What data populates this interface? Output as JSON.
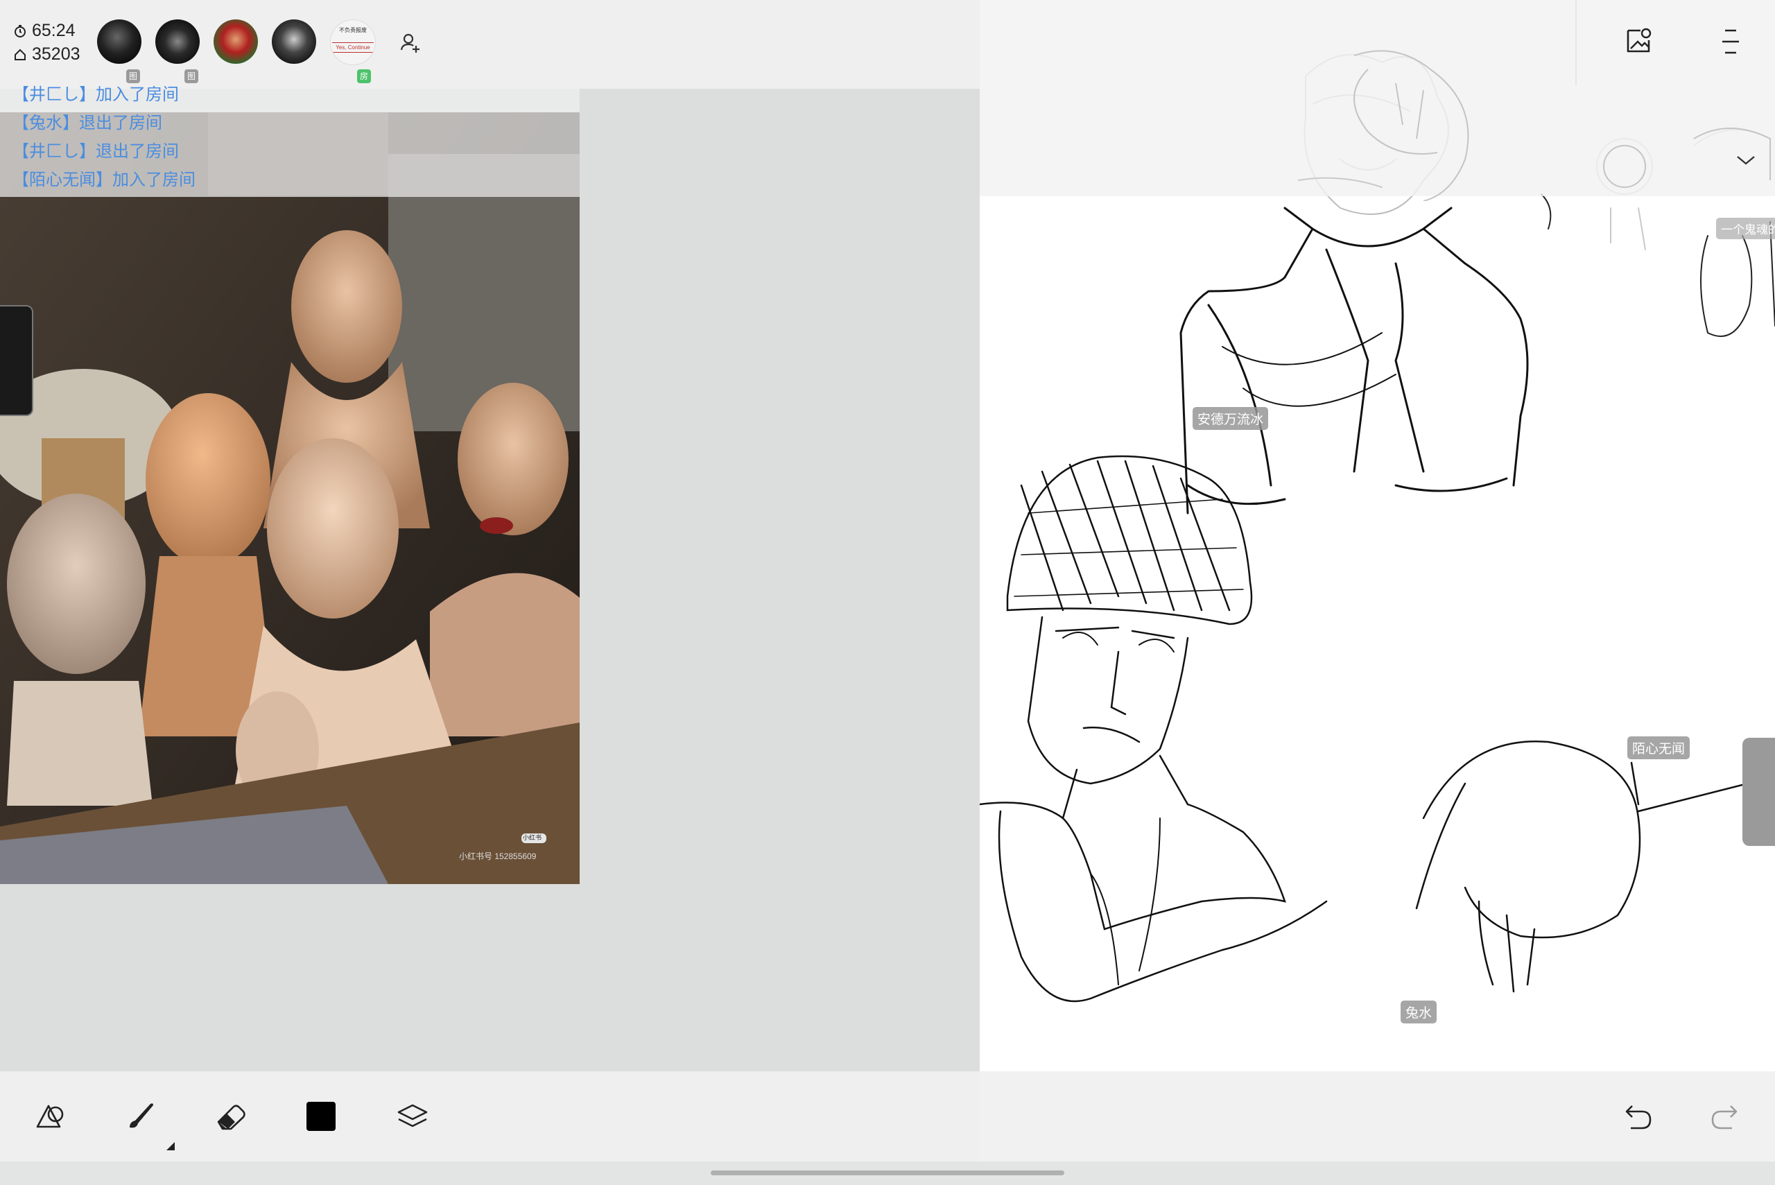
{
  "status": {
    "timer": "65:24",
    "room_number": "35203",
    "timer_icon": "clock-icon",
    "room_icon": "home-icon"
  },
  "members": [
    {
      "name": "member-1",
      "badge": "图"
    },
    {
      "name": "member-2",
      "badge": "图"
    },
    {
      "name": "member-3",
      "badge": ""
    },
    {
      "name": "member-4",
      "badge": ""
    },
    {
      "name": "member-5",
      "badge": "房",
      "avatar_text_top": "不负责报废",
      "avatar_text_bottom": "Yes, Continue"
    }
  ],
  "chat_log": [
    "【井匚し】加入了房间",
    "【兔水】退出了房间",
    "【井匚し】退出了房间",
    "【陌心无闻】加入了房间"
  ],
  "reference_image": {
    "watermark_brand": "小红书",
    "watermark_id": "小红书号 152855609"
  },
  "canvas_user_tags": [
    "安德万流冰",
    "陌心无闻",
    "兔水",
    "一个鬼魂的"
  ],
  "toolbar": {
    "tools": [
      "shapes-icon",
      "brush-icon",
      "eraser-icon",
      "color-swatch",
      "layers-icon"
    ],
    "color": "#000000",
    "undo_icon": "undo-icon",
    "redo_icon": "redo-icon"
  },
  "colors": {
    "chat_text": "#4a8de0",
    "canvas_bg": "#ffffff",
    "panel_bg": "#dcdddd",
    "toolbar_bg": "#efefef"
  }
}
